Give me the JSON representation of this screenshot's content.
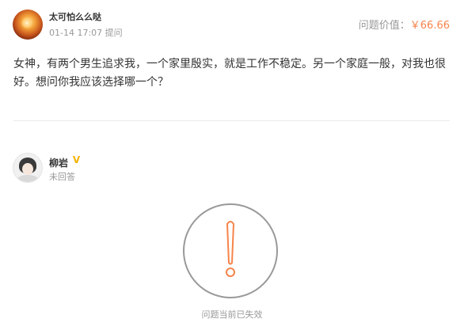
{
  "asker": {
    "name": "太可怕么么哒",
    "time": "01-14 17:07 提问",
    "avatar_icon": "flame-ball-avatar"
  },
  "price": {
    "label": "问题价值：",
    "value": "￥66.66",
    "color": "#f7844a"
  },
  "question": {
    "text": "女神，有两个男生追求我，一个家里殷实，就是工作不稳定。另一个家庭一般，对我也很好。想问你我应该选择哪一个？"
  },
  "answerer": {
    "name": "柳岩",
    "verified_icon": "v-badge-icon",
    "verified_color": "#f5b400",
    "status": "未回答"
  },
  "invalid": {
    "icon": "exclamation-circle-icon",
    "icon_accent": "#f7844a",
    "text": "问题当前已失效"
  }
}
